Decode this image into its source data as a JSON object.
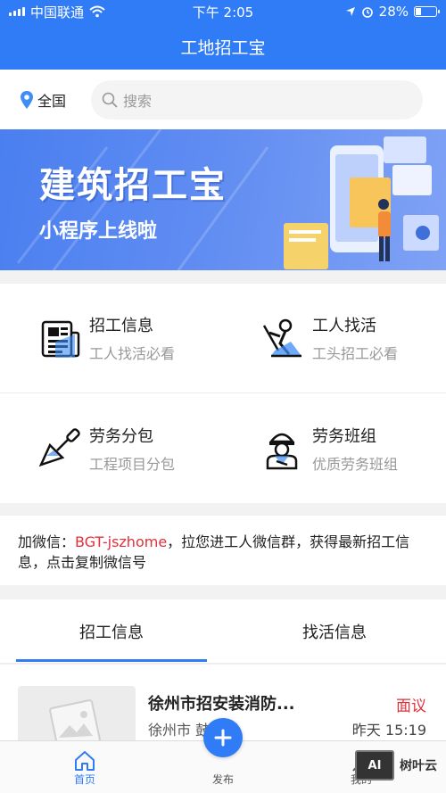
{
  "status_bar": {
    "carrier": "中国联通",
    "time": "下午 2:05",
    "battery": "28%",
    "battery_level": 0.28
  },
  "nav": {
    "title": "工地招工宝"
  },
  "location": {
    "label": "全国"
  },
  "search": {
    "placeholder": "搜索"
  },
  "banner": {
    "title": "建筑招工宝",
    "subtitle": "小程序上线啦"
  },
  "categories": [
    {
      "title": "招工信息",
      "subtitle": "工人找活必看",
      "icon": "newspaper-icon"
    },
    {
      "title": "工人找活",
      "subtitle": "工头招工必看",
      "icon": "worker-digging-icon"
    },
    {
      "title": "劳务分包",
      "subtitle": "工程项目分包",
      "icon": "trowel-icon"
    },
    {
      "title": "劳务班组",
      "subtitle": "优质劳务班组",
      "icon": "worker-helmet-icon"
    }
  ],
  "wechat_notice": {
    "prefix": "加微信：",
    "wechat_id": "BGT-jszhome",
    "suffix": "，拉您进工人微信群，获得最新招工信息，点击复制微信号"
  },
  "list_tabs": [
    {
      "label": "招工信息",
      "active": true
    },
    {
      "label": "找活信息",
      "active": false
    }
  ],
  "listing": {
    "title": "徐州市招安装消防...",
    "price": "面议",
    "location": "徐州市 鼓楼区",
    "time": "昨天  15:19"
  },
  "tab_bar": {
    "home": "首页",
    "publish": "发布",
    "mine": "我的"
  },
  "watermark": {
    "text": "树叶云",
    "logo": "AI"
  },
  "colors": {
    "primary": "#2f7cf6",
    "accent_red": "#e0303a",
    "muted": "#999999"
  }
}
